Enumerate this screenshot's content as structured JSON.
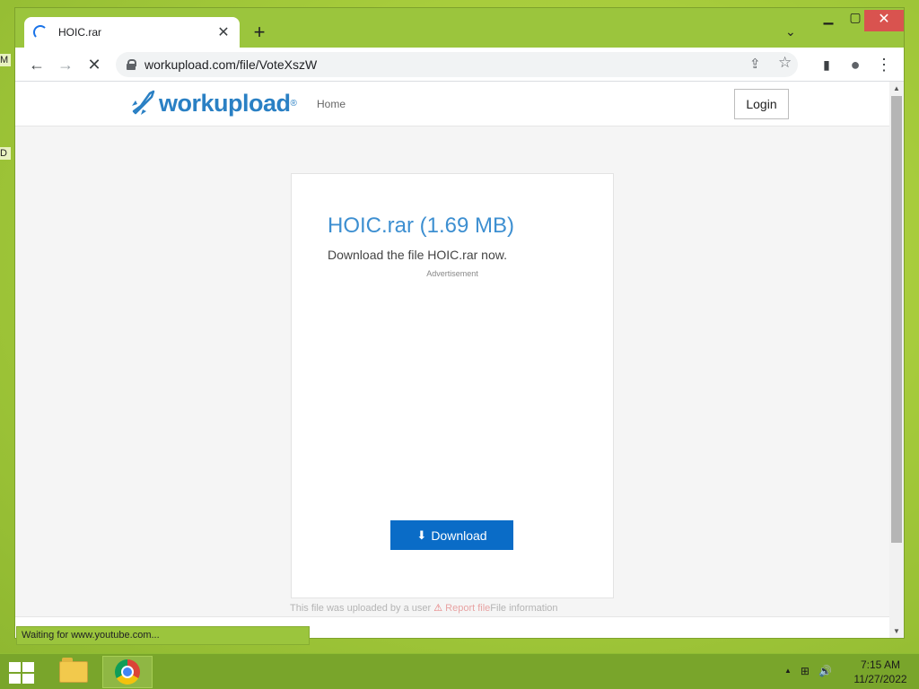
{
  "desktop": {
    "edge_labels": [
      "M",
      "D"
    ]
  },
  "browser": {
    "tab": {
      "title": "HOIC.rar",
      "close_glyph": "✕"
    },
    "new_tab_glyph": "+",
    "tab_search_glyph": "⌄",
    "window_controls": {
      "minimize": "▁",
      "maximize": "▢",
      "close": "✕"
    },
    "toolbar": {
      "back_glyph": "←",
      "forward_glyph": "→",
      "stop_glyph": "✕",
      "url": "workupload.com/file/VoteXszW",
      "share_glyph": "⇪",
      "bookmark_glyph": "☆",
      "sidepanel_glyph": "▮",
      "profile_glyph": "●",
      "menu_glyph": "⋮"
    },
    "status_text": "Waiting for www.youtube.com..."
  },
  "site": {
    "logo": {
      "text": "workupload",
      "reg": "®"
    },
    "nav_home": "Home",
    "login_label": "Login",
    "file": {
      "title": "HOIC.rar (1.69 MB)",
      "subtitle": "Download the file HOIC.rar now.",
      "ad_label": "Advertisement",
      "download_label": "Download",
      "download_icon": "⬇"
    },
    "footer": {
      "uploaded_by": "This file was uploaded by a user",
      "warn_icon": "⚠",
      "report": "Report file",
      "info": "File information"
    }
  },
  "scrollbar": {
    "up": "▲",
    "down": "▼"
  },
  "taskbar": {
    "tray_icons": {
      "up_arrow": "▲",
      "network": "⊞",
      "volume": "🔊"
    },
    "time": "7:15 AM",
    "date": "11/27/2022"
  },
  "colors": {
    "desktop_green": "#a3c93a",
    "brand_blue": "#2a80c4",
    "download_blue": "#0a6cc7",
    "close_red": "#d9534f"
  }
}
